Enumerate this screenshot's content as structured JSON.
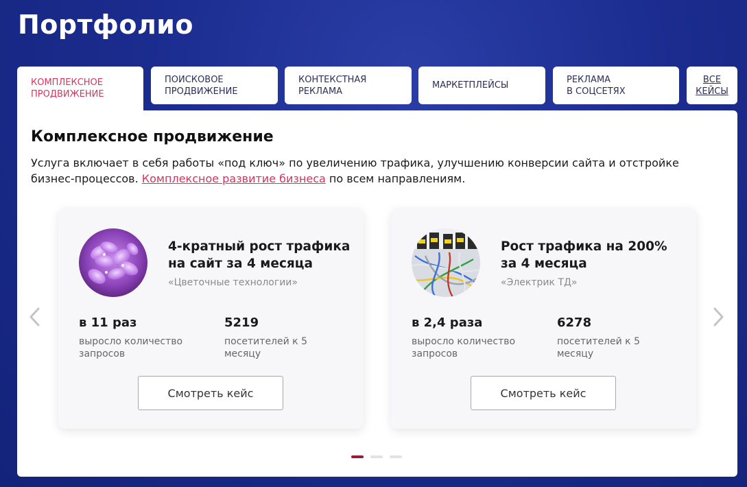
{
  "page": {
    "title": "Портфолио"
  },
  "tabs": [
    {
      "line1": "КОМПЛЕКСНОЕ",
      "line2": "ПРОДВИЖЕНИЕ"
    },
    {
      "line1": "ПОИСКОВОЕ",
      "line2": "ПРОДВИЖЕНИЕ"
    },
    {
      "line1": "КОНТЕКСТНАЯ",
      "line2": "РЕКЛАМА"
    },
    {
      "line1": "МАРКЕТПЛЕЙСЫ",
      "line2": ""
    },
    {
      "line1": "РЕКЛАМА",
      "line2": "В СОЦСЕТЯХ"
    },
    {
      "line1": "ВСЕ",
      "line2": "КЕЙСЫ"
    }
  ],
  "active_tab_index": 0,
  "section": {
    "title": "Комплексное продвижение",
    "desc_before": "Услуга включает в себя работы «под ключ» по увеличению трафика, улучшению конверсии сайта и отстройке бизнес-процессов. ",
    "desc_link": "Комплексное развитие бизнеса",
    "desc_after": " по всем направлениям."
  },
  "cards": [
    {
      "title": "4-кратный рост трафика на сайт за 4 месяца",
      "client": "«Цветочные технологии»",
      "image_icon": "flowers-photo",
      "stat1_value": "в 11 раз",
      "stat1_label": "выросло количество запросов",
      "stat2_value": "5219",
      "stat2_label": "посетителей к 5 месяцу",
      "button": "Смотреть кейс"
    },
    {
      "title": "Рост трафика на 200% за 4 месяца",
      "client": "«Электрик ТД»",
      "image_icon": "electrical-panel-photo",
      "stat1_value": "в 2,4 раза",
      "stat1_label": "выросло количество запросов",
      "stat2_value": "6278",
      "stat2_label": "посетителей к 5 месяцу",
      "button": "Смотреть кейс"
    }
  ],
  "slider": {
    "total_dots": 3,
    "active_dot": 1
  },
  "colors": {
    "background": "#1b2c8f",
    "accent": "#d8345f",
    "active_dot": "#9c1c2f",
    "tab_text": "#2b2f55"
  }
}
